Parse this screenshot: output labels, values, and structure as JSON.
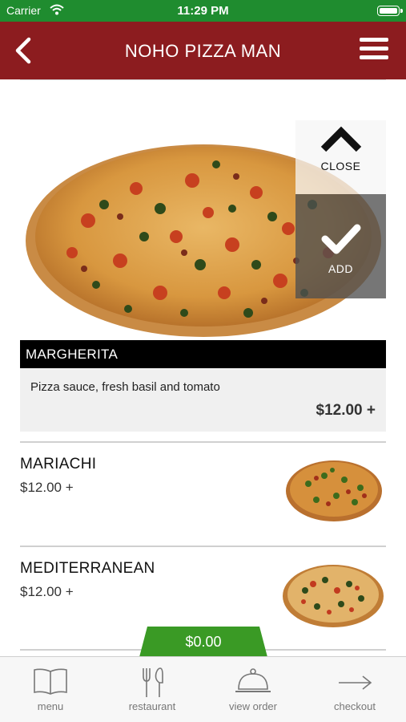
{
  "status_bar": {
    "carrier": "Carrier",
    "time": "11:29 PM"
  },
  "nav": {
    "title": "NOHO PIZZA MAN",
    "back_icon": "chevron-left-icon",
    "menu_icon": "hamburger-icon"
  },
  "featured": {
    "name": "MARGHERITA",
    "description": "Pizza sauce, fresh basil and tomato",
    "price": "$12.00 +",
    "close_label": "CLOSE",
    "add_label": "ADD"
  },
  "items": [
    {
      "name": "MARIACHI",
      "price": "$12.00 +"
    },
    {
      "name": "MEDITERRANEAN",
      "price": "$12.00 +"
    }
  ],
  "order_total": "$0.00",
  "tabs": [
    {
      "label": "menu",
      "icon": "book-icon"
    },
    {
      "label": "restaurant",
      "icon": "fork-knife-icon"
    },
    {
      "label": "view order",
      "icon": "cloche-icon"
    },
    {
      "label": "checkout",
      "icon": "arrow-right-icon"
    }
  ],
  "colors": {
    "status_bar": "#1f8c2f",
    "nav_bar": "#8c1c1f",
    "total_tab": "#3a9a25"
  }
}
